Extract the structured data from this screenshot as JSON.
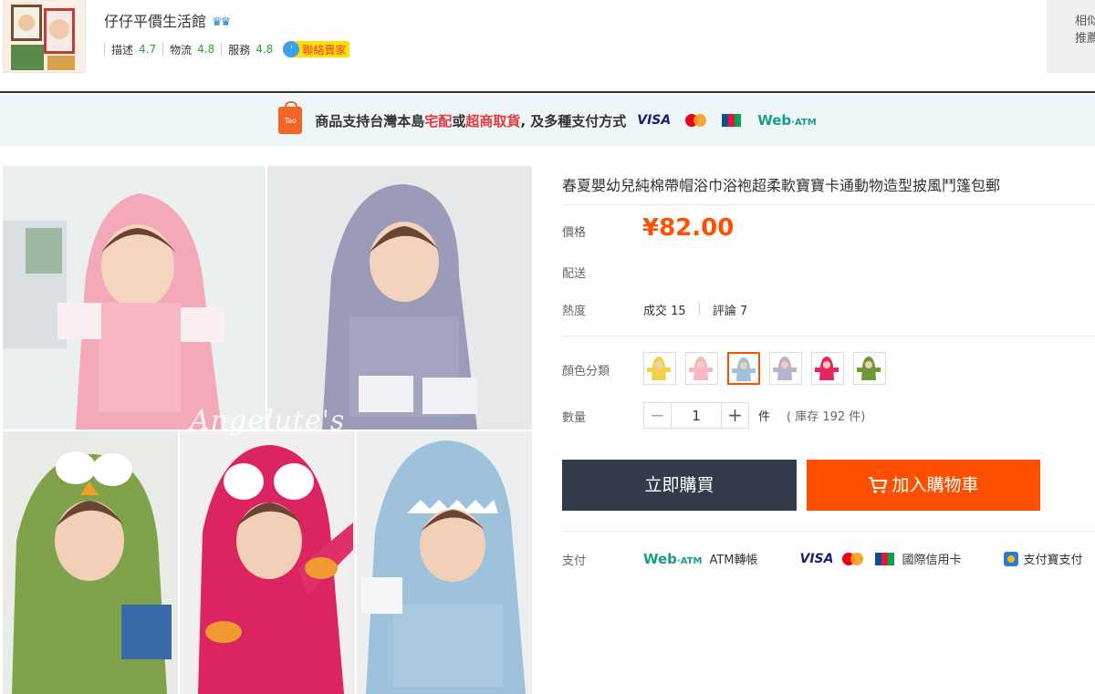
{
  "shop": {
    "name": "仔仔平價生活館",
    "crown_icon": "crown-icon",
    "ratings": [
      {
        "label": "描述",
        "value": "4.7"
      },
      {
        "label": "物流",
        "value": "4.8"
      },
      {
        "label": "服務",
        "value": "4.8"
      }
    ],
    "contact_label": "聯絡賣家",
    "similar_label_1": "相似",
    "similar_label_2": "推薦"
  },
  "banner": {
    "prefix": "商品支持台灣本島",
    "option_1": "宅配",
    "or": "或",
    "option_2": "超商取貨",
    "suffix": ", 及多種支付方式",
    "visa": "VISA",
    "web_atm": "Web",
    "web_atm_suffix": "·ATM",
    "tao_label": "Tao"
  },
  "gallery": {
    "watermark": "Angelute's"
  },
  "product": {
    "title": "春夏嬰幼兒純棉帶帽浴巾浴袍超柔軟寶寶卡通動物造型披風鬥篷包郵",
    "price_label": "價格",
    "price": "¥82.00",
    "delivery_label": "配送",
    "heat_label": "熱度",
    "sales_label": "成交",
    "sales_count": "15",
    "reviews_label": "評論",
    "reviews_count": "7",
    "color_label": "顏色分類",
    "colors": [
      "#f2d24a",
      "#f4b8c4",
      "#9fc2dc",
      "#b6b3cf",
      "#e6245f",
      "#6f9a3a"
    ],
    "selected_color_index": 2,
    "qty_label": "數量",
    "qty": "1",
    "qty_minus": "−",
    "qty_plus": "+",
    "unit": "件",
    "stock": "( 庫存 192 件)",
    "buy_now": "立即購買",
    "add_to_cart": "加入購物車",
    "pay_label": "支付",
    "pay_web": "Web",
    "pay_web_suffix": "·ATM",
    "pay_atm": "ATM轉帳",
    "pay_visa": "VISA",
    "pay_card": "國際信用卡",
    "pay_alipay": "支付寶支付"
  },
  "colors": {
    "accent": "#ff5000",
    "buy_bg": "#333b4a",
    "rating_value": "#2fa335",
    "banner_bg": "#eef6fa"
  }
}
